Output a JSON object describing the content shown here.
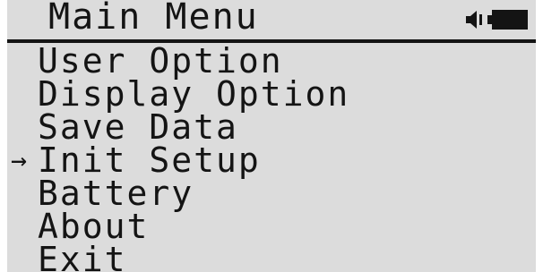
{
  "header": {
    "title": "Main Menu",
    "status_icons": [
      "speaker-icon",
      "battery-icon"
    ]
  },
  "cursor": {
    "glyph": "→"
  },
  "menu": {
    "items": [
      {
        "label": "User Option"
      },
      {
        "label": "Display Option"
      },
      {
        "label": "Save Data"
      },
      {
        "label": "Init Setup",
        "selected": true
      },
      {
        "label": "Battery"
      },
      {
        "label": "About"
      },
      {
        "label": "Exit"
      }
    ]
  },
  "colors": {
    "screen_background": "#dcdcdc",
    "foreground": "#141414"
  }
}
